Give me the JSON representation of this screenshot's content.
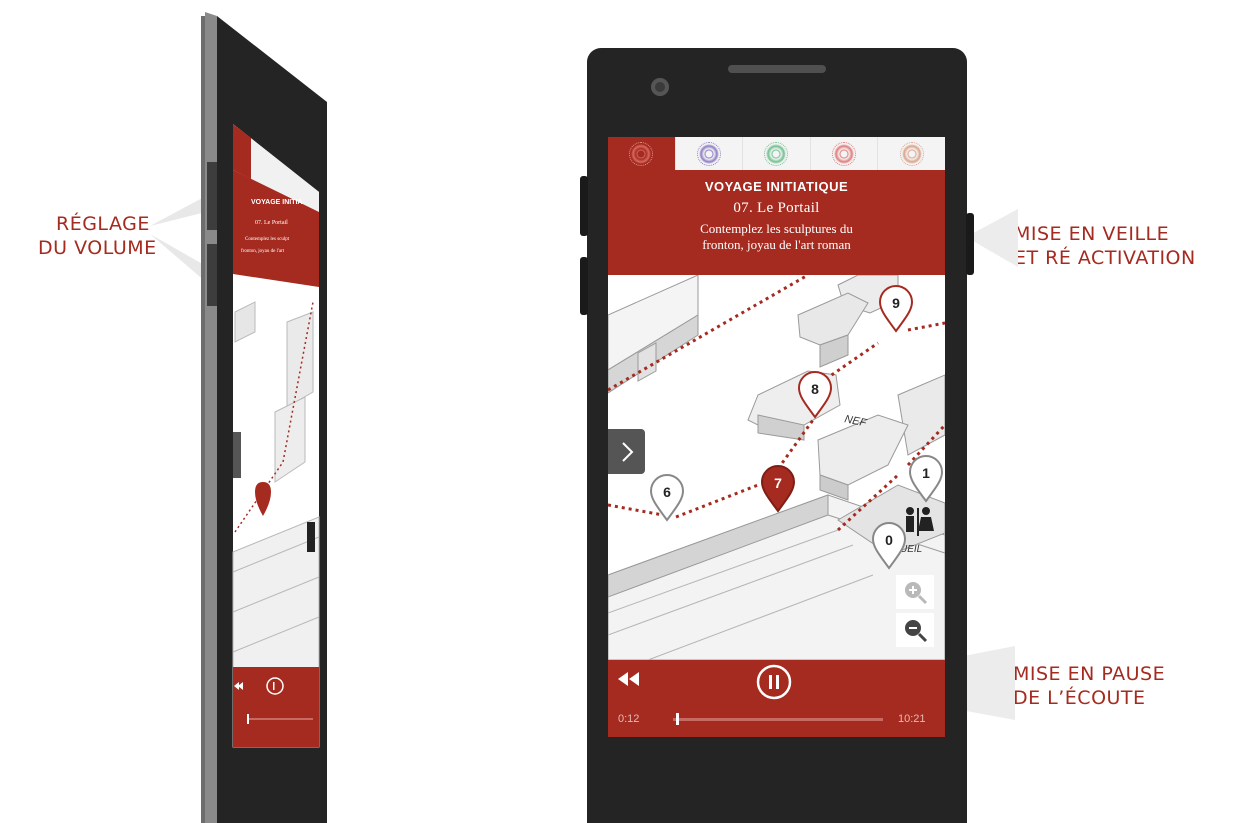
{
  "callouts": {
    "volume": [
      "RÉGLAGE",
      "DU VOLUME"
    ],
    "sleep": [
      "MISE EN VEILLE",
      "ET RÉ ACTIVATION"
    ],
    "pause": [
      "MISE EN PAUSE",
      "DE L’ÉCOUTE"
    ]
  },
  "tabs": [
    {
      "name": "tour-1",
      "color": "#c0392b",
      "active": true
    },
    {
      "name": "tour-2",
      "color": "#8e7cc3",
      "active": false
    },
    {
      "name": "tour-3",
      "color": "#6fbf8f",
      "active": false
    },
    {
      "name": "tour-4",
      "color": "#e07a7a",
      "active": false
    },
    {
      "name": "tour-5",
      "color": "#d9a38a",
      "active": false
    }
  ],
  "header": {
    "tour_title": "VOYAGE INITIATIQUE",
    "stop_title": "07. Le Portail",
    "stop_desc_line1": "Contemplez les sculptures du",
    "stop_desc_line2": "fronton, joyau de l'art roman"
  },
  "map": {
    "nave_label": "NEF",
    "markers": [
      "9",
      "8",
      "7",
      "6",
      "1",
      "0"
    ],
    "active_marker": "7",
    "restroom_label": "UEIL"
  },
  "player": {
    "elapsed": "0:12",
    "total": "10:21",
    "progress": 0.02
  },
  "icons": {
    "expand": "chevron-right-icon",
    "zoom_in": "zoom-in-icon",
    "zoom_out": "zoom-out-icon",
    "rewind": "rewind-icon",
    "pause": "pause-icon",
    "restroom": "restroom-icon"
  },
  "colors": {
    "brand_red": "#a52a1f",
    "phone_body": "#242424"
  }
}
